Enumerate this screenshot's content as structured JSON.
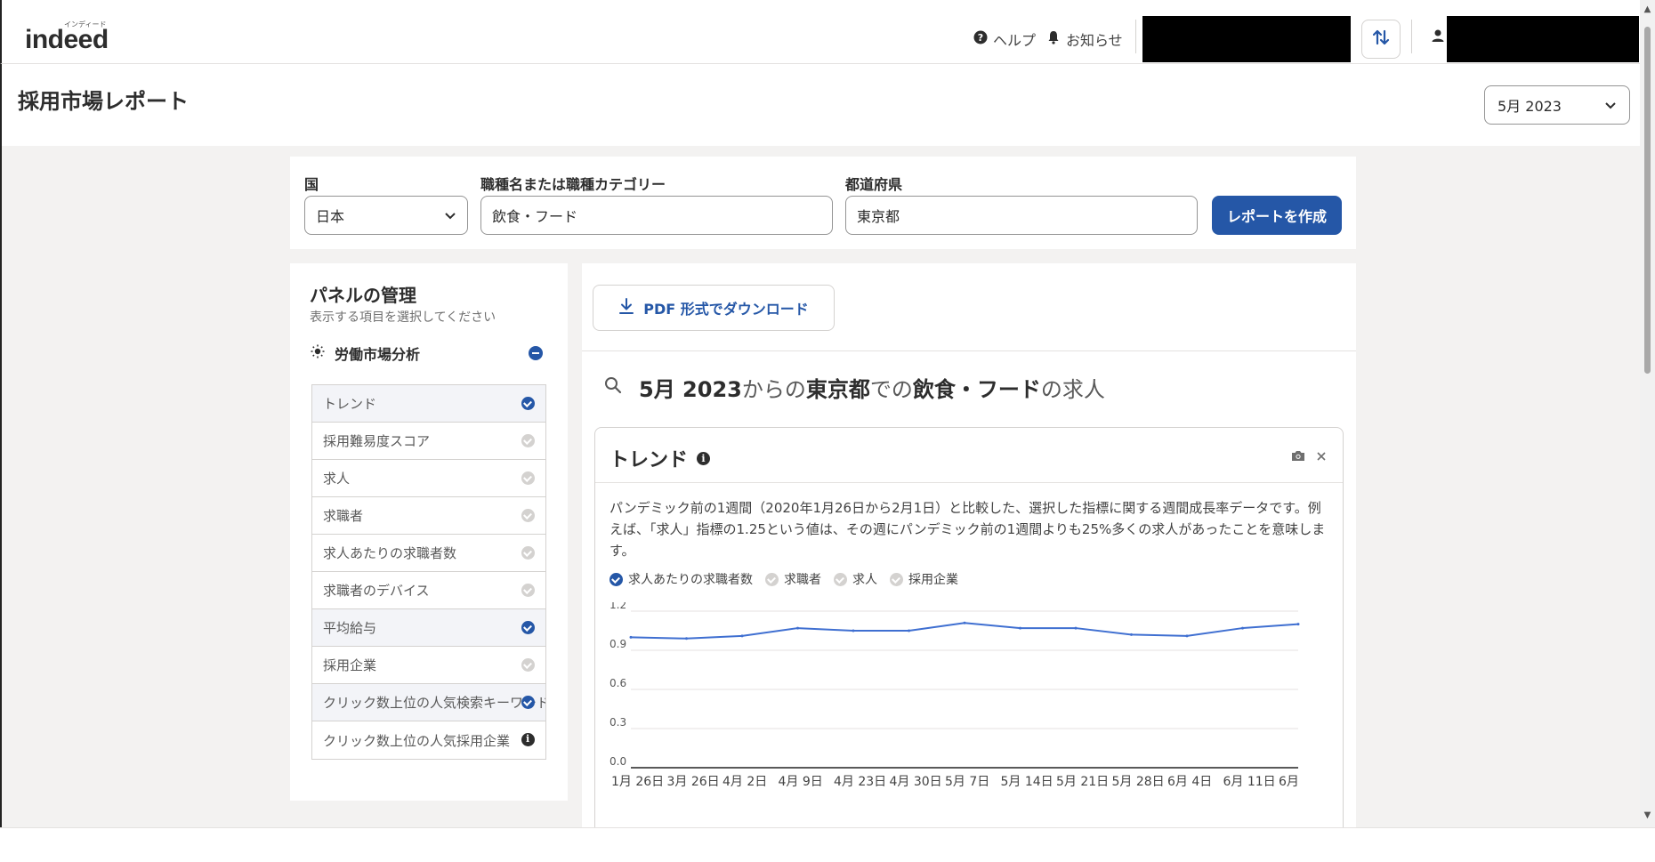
{
  "header": {
    "logo_text": "indeed",
    "logo_sup": "インディード",
    "help": "ヘルプ",
    "notifications": "お知らせ"
  },
  "page": {
    "title": "採用市場レポート",
    "month_select": "5月 2023"
  },
  "search": {
    "country_label": "国",
    "country_value": "日本",
    "job_label": "職種名または職種カテゴリー",
    "job_value": "飲食・フード",
    "pref_label": "都道府県",
    "pref_value": "東京都",
    "submit": "レポートを作成"
  },
  "panel": {
    "title": "パネルの管理",
    "subtitle": "表示する項目を選択してください",
    "section": "労働市場分析",
    "items": [
      {
        "label": "トレンド",
        "state": "on"
      },
      {
        "label": "採用難易度スコア",
        "state": "off"
      },
      {
        "label": "求人",
        "state": "off"
      },
      {
        "label": "求職者",
        "state": "off"
      },
      {
        "label": "求人あたりの求職者数",
        "state": "off"
      },
      {
        "label": "求職者のデバイス",
        "state": "off"
      },
      {
        "label": "平均給与",
        "state": "on"
      },
      {
        "label": "採用企業",
        "state": "off"
      },
      {
        "label": "クリック数上位の人気検索キーワード",
        "state": "on"
      },
      {
        "label": "クリック数上位の人気採用企業",
        "state": "info"
      }
    ]
  },
  "main": {
    "pdf_button": "PDF 形式でダウンロード",
    "query": {
      "month": "5月 2023",
      "from": "からの",
      "location": "東京都",
      "at": "での",
      "job": "飲食・フード",
      "suffix": "の求人"
    }
  },
  "trend": {
    "title": "トレンド",
    "description": "パンデミック前の1週間（2020年1月26日から2月1日）と比較した、選択した指標に関する週間成長率データです。例えば、「求人」指標の1.25という値は、その週にパンデミック前の1週間よりも25%多くの求人があったことを意味します。",
    "legend": [
      {
        "label": "求人あたりの求職者数",
        "active": true
      },
      {
        "label": "求職者",
        "active": false
      },
      {
        "label": "求人",
        "active": false
      },
      {
        "label": "採用企業",
        "active": false
      }
    ]
  },
  "chart_data": {
    "type": "line",
    "x": [
      "1月 26日",
      "3月 26日",
      "4月 2日",
      "4月 9日",
      "4月 23日",
      "4月 30日",
      "5月 7日",
      "5月 14日",
      "5月 21日",
      "5月 28日",
      "6月 4日",
      "6月 11日",
      "6月"
    ],
    "series": [
      {
        "name": "求人あたりの求職者数",
        "values": [
          1.0,
          0.99,
          1.01,
          1.07,
          1.05,
          1.05,
          1.11,
          1.07,
          1.07,
          1.02,
          1.01,
          1.07,
          1.1
        ]
      }
    ],
    "yticks": [
      "1.2",
      "0.9",
      "0.6",
      "0.3",
      "0.0"
    ],
    "ylim": [
      0,
      1.2
    ],
    "grid": true,
    "color": "#3f6fd1"
  }
}
